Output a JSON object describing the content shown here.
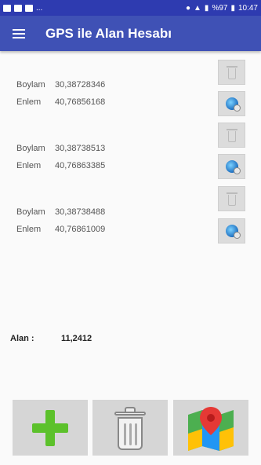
{
  "status_bar": {
    "battery": "%97",
    "time": "10:47",
    "ellipsis": "..."
  },
  "app_bar": {
    "title": "GPS ile Alan Hesabı",
    "menu_icon": "hamburger-menu-icon"
  },
  "points": [
    {
      "boylam_label": "Boylam",
      "boylam": "30,38728346",
      "enlem_label": "Enlem",
      "enlem": "40,76856168"
    },
    {
      "boylam_label": "Boylam",
      "boylam": "30,38738513",
      "enlem_label": "Enlem",
      "enlem": "40,76863385"
    },
    {
      "boylam_label": "Boylam",
      "boylam": "30,38738488",
      "enlem_label": "Enlem",
      "enlem": "40,76861009"
    }
  ],
  "area": {
    "label": "Alan :",
    "value": "11,2412"
  },
  "bottom_buttons": [
    "add-point",
    "delete-all",
    "show-on-map"
  ],
  "colors": {
    "status_bar": "#2e3bb0",
    "app_bar": "#3f51b5",
    "plus": "#5cc12b"
  }
}
